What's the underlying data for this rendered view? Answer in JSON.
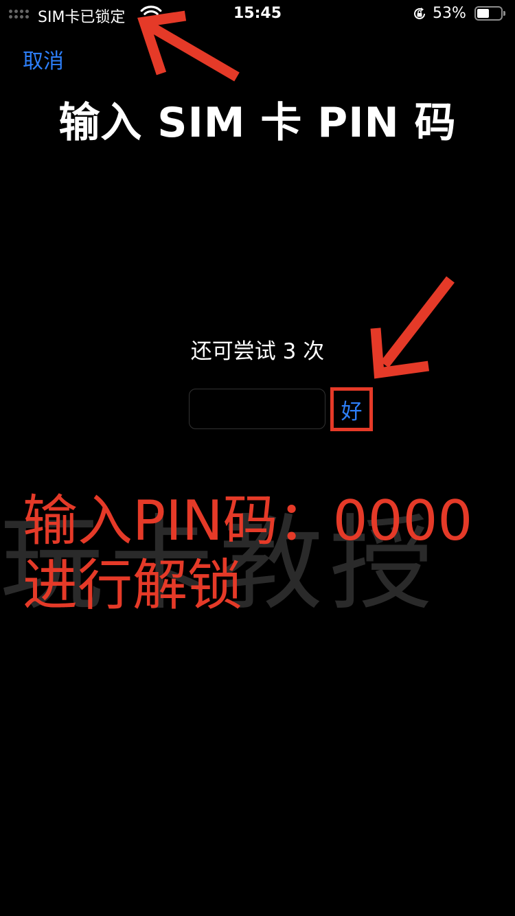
{
  "status_bar": {
    "carrier": "SIM卡已锁定",
    "time": "15:45",
    "battery_percent": "53%",
    "battery_level": 0.53,
    "icons": [
      "signal-dots-icon",
      "wifi-icon",
      "orientation-lock-icon",
      "battery-icon"
    ]
  },
  "header": {
    "cancel_label": "取消",
    "title": "输入 SIM 卡 PIN 码"
  },
  "pin_entry": {
    "attempts_text": "还可尝试 3 次",
    "input_value": "",
    "ok_label": "好"
  },
  "annotation": {
    "line1": "输入PIN码：0000",
    "line2": "进行解锁",
    "color": "#e53a28"
  },
  "watermark": "玩卡教授",
  "colors": {
    "background": "#000000",
    "accent_blue": "#2d7ff9",
    "annotation_red": "#e53a28"
  }
}
